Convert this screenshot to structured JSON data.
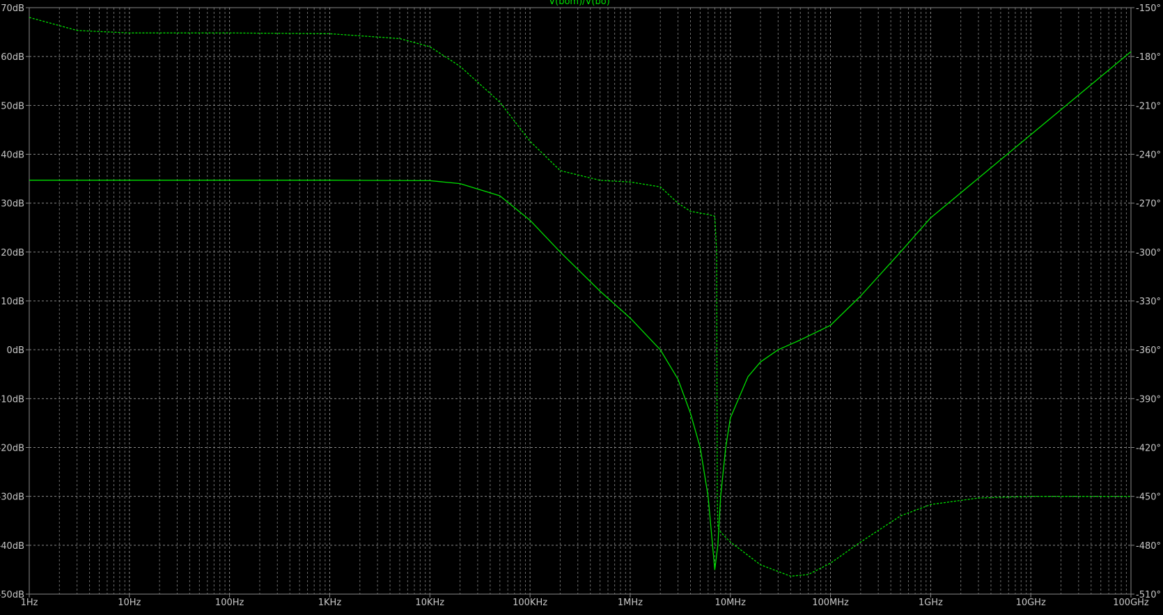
{
  "chart_data": {
    "type": "line",
    "title": "V(bom)/V(bo)",
    "x_scale": "log",
    "xlim_hz": [
      1,
      100000000000
    ],
    "x_ticks": [
      {
        "value": 1,
        "label": "1Hz"
      },
      {
        "value": 10,
        "label": "10Hz"
      },
      {
        "value": 100,
        "label": "100Hz"
      },
      {
        "value": 1000,
        "label": "1KHz"
      },
      {
        "value": 10000,
        "label": "10KHz"
      },
      {
        "value": 100000,
        "label": "100KHz"
      },
      {
        "value": 1000000,
        "label": "1MHz"
      },
      {
        "value": 10000000,
        "label": "10MHz"
      },
      {
        "value": 100000000,
        "label": "100MHz"
      },
      {
        "value": 1000000000,
        "label": "1GHz"
      },
      {
        "value": 10000000000,
        "label": "10GHz"
      },
      {
        "value": 100000000000,
        "label": "100GHz"
      }
    ],
    "y_left": {
      "unit": "dB",
      "ylim": [
        -50,
        70
      ],
      "ticks": [
        {
          "value": 70,
          "label": "70dB"
        },
        {
          "value": 60,
          "label": "60dB"
        },
        {
          "value": 50,
          "label": "50dB"
        },
        {
          "value": 40,
          "label": "40dB"
        },
        {
          "value": 30,
          "label": "30dB"
        },
        {
          "value": 20,
          "label": "20dB"
        },
        {
          "value": 10,
          "label": "10dB"
        },
        {
          "value": 0,
          "label": "0dB"
        },
        {
          "value": -10,
          "label": "-10dB"
        },
        {
          "value": -20,
          "label": "-20dB"
        },
        {
          "value": -30,
          "label": "-30dB"
        },
        {
          "value": -40,
          "label": "-40dB"
        },
        {
          "value": -50,
          "label": "-50dB"
        }
      ]
    },
    "y_right": {
      "unit": "°",
      "ylim": [
        -510,
        -150
      ],
      "ticks": [
        {
          "value": -150,
          "label": "-150°"
        },
        {
          "value": -180,
          "label": "-180°"
        },
        {
          "value": -210,
          "label": "-210°"
        },
        {
          "value": -240,
          "label": "-240°"
        },
        {
          "value": -270,
          "label": "-270°"
        },
        {
          "value": -300,
          "label": "-300°"
        },
        {
          "value": -330,
          "label": "-330°"
        },
        {
          "value": -360,
          "label": "-360°"
        },
        {
          "value": -390,
          "label": "-390°"
        },
        {
          "value": -420,
          "label": "-420°"
        },
        {
          "value": -450,
          "label": "-450°"
        },
        {
          "value": -480,
          "label": "-480°"
        },
        {
          "value": -510,
          "label": "-510°"
        }
      ]
    },
    "grid": true,
    "legend": "none",
    "series": [
      {
        "axis": "left",
        "style": "solid",
        "x_hz": [
          1,
          10,
          100,
          1000,
          10000,
          20000,
          50000,
          100000,
          200000,
          500000,
          1000000,
          2000000,
          3000000,
          4000000,
          5000000,
          6000000,
          7000000,
          7500000,
          8000000,
          9000000,
          10000000,
          15000000,
          20000000,
          30000000,
          50000000,
          100000000,
          200000000,
          500000000,
          1000000000,
          10000000000,
          100000000000
        ],
        "y": [
          34.7,
          34.7,
          34.7,
          34.7,
          34.6,
          34.0,
          31.5,
          26.5,
          20.0,
          12.0,
          6.5,
          0.0,
          -6.0,
          -13.0,
          -20.0,
          -30.0,
          -45.0,
          -40.0,
          -30.0,
          -20.0,
          -14.0,
          -5.5,
          -2.5,
          0.0,
          2.0,
          5.0,
          11.0,
          20.0,
          27.0,
          44.0,
          61.0
        ]
      },
      {
        "axis": "right",
        "style": "dashed",
        "x_hz": [
          1,
          3,
          10,
          100,
          1000,
          5000,
          10000,
          20000,
          50000,
          100000,
          200000,
          500000,
          1000000,
          2000000,
          3000000,
          4000000,
          6000000,
          7000000,
          7300000,
          7400000,
          7500000,
          8000000,
          10000000,
          20000000,
          40000000,
          60000000,
          100000000,
          200000000,
          500000000,
          1000000000,
          3000000000,
          10000000000,
          100000000000
        ],
        "y": [
          -156,
          -164,
          -165.5,
          -165.5,
          -166,
          -169,
          -174,
          -186,
          -208,
          -232,
          -250,
          -256,
          -257,
          -260,
          -270,
          -275,
          -277,
          -278,
          -300,
          -450,
          -469,
          -472,
          -478,
          -492,
          -499,
          -498,
          -491,
          -478,
          -462,
          -455,
          -451,
          -450,
          -450
        ]
      }
    ]
  }
}
